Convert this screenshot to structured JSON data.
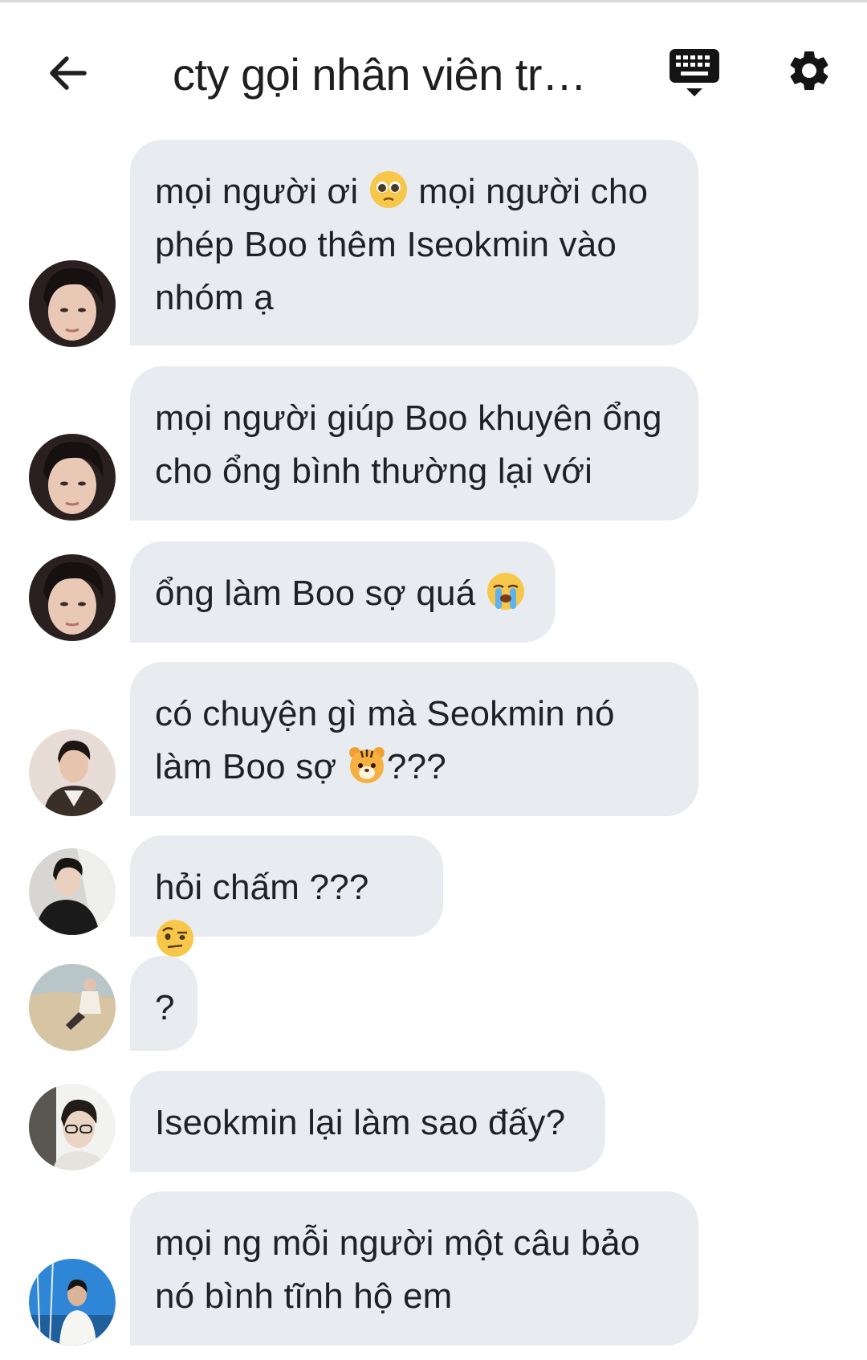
{
  "header": {
    "title": "cty gọi nhân viên trả…",
    "back_icon": "arrow-left-icon",
    "keyboard_icon": "keyboard-icon",
    "settings_icon": "gear-icon"
  },
  "messages": [
    {
      "avatar": "avatar-a",
      "text_before": "mọi người ơi ",
      "emoji": "pleading-face",
      "text_after": " mọi người cho phép Boo thêm Iseokmin vào nhóm ạ"
    },
    {
      "avatar": "avatar-a",
      "text_before": "mọi người giúp Boo khuyên ổng cho ổng bình thường lại với",
      "emoji": "",
      "text_after": ""
    },
    {
      "avatar": "avatar-a",
      "text_before": "ổng làm Boo sợ quá ",
      "emoji": "loudly-crying-face",
      "text_after": ""
    },
    {
      "avatar": "avatar-b",
      "text_before": "có chuyện gì mà Seokmin nó làm Boo sợ ",
      "emoji": "tiger-face",
      "text_after": "???"
    },
    {
      "avatar": "avatar-c",
      "text_before": "hỏi chấm ??? ",
      "emoji": "face-with-raised-eyebrow",
      "text_after": ""
    },
    {
      "avatar": "avatar-d",
      "text_before": "?",
      "emoji": "",
      "text_after": ""
    },
    {
      "avatar": "avatar-e",
      "text_before": "Iseokmin lại làm sao đấy?",
      "emoji": "",
      "text_after": ""
    },
    {
      "avatar": "avatar-f",
      "text_before": "mọi ng mỗi người một câu bảo nó bình tĩnh hộ em",
      "emoji": "",
      "text_after": ""
    }
  ],
  "colors": {
    "bubble": "#e8ebef",
    "text": "#202124",
    "background": "#ffffff"
  }
}
